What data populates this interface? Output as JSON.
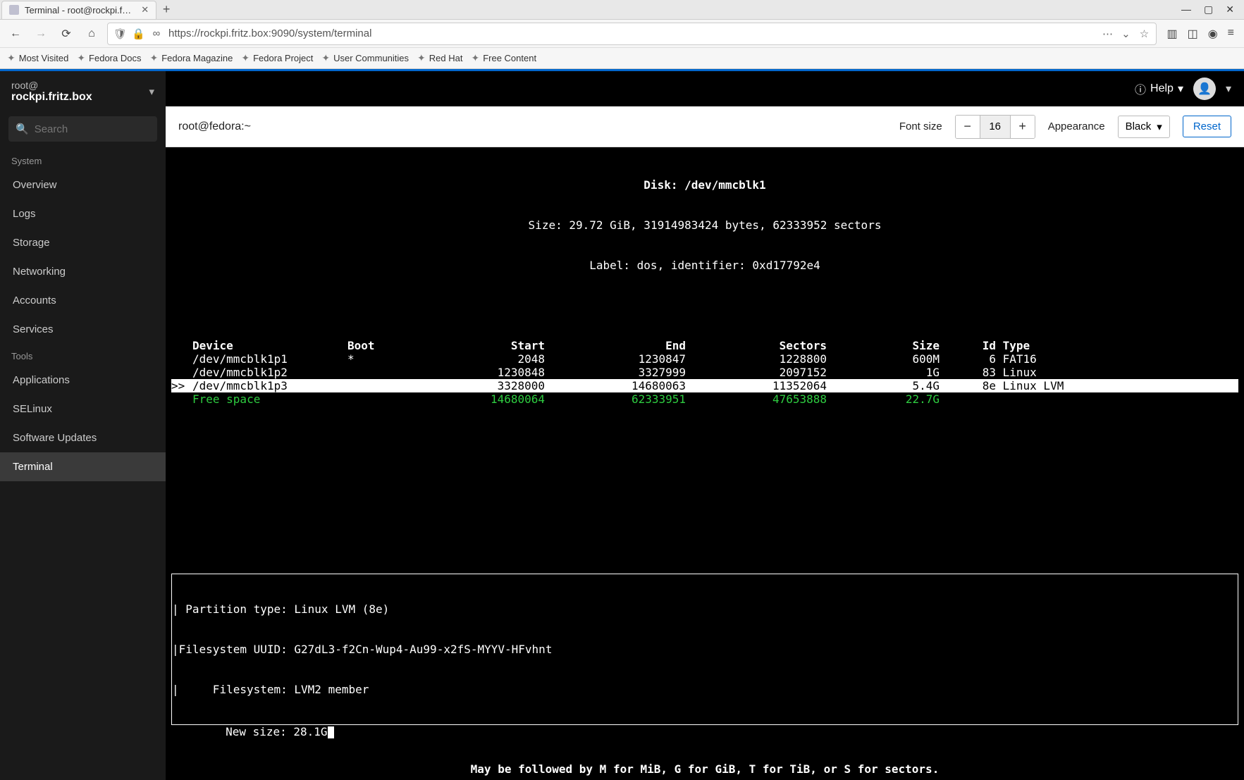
{
  "browser": {
    "tab_title": "Terminal - root@rockpi.f…",
    "url": "https://rockpi.fritz.box:9090/system/terminal",
    "window_controls": {
      "min": "—",
      "max": "▢",
      "close": "✕"
    },
    "bookmarks": [
      "Most Visited",
      "Fedora Docs",
      "Fedora Magazine",
      "Fedora Project",
      "User Communities",
      "Red Hat",
      "Free Content"
    ]
  },
  "sidebar": {
    "user": "root@",
    "host": "rockpi.fritz.box",
    "search_placeholder": "Search",
    "sections": {
      "system": {
        "label": "System",
        "items": [
          "Overview",
          "Logs",
          "Storage",
          "Networking",
          "Accounts",
          "Services"
        ]
      },
      "tools": {
        "label": "Tools",
        "items": [
          "Applications",
          "SELinux",
          "Software Updates",
          "Terminal"
        ]
      }
    },
    "active": "Terminal"
  },
  "header": {
    "help_label": "Help"
  },
  "toolbar": {
    "prompt": "root@fedora:~",
    "font_size_label": "Font size",
    "font_size_value": "16",
    "appearance_label": "Appearance",
    "appearance_value": "Black",
    "reset_label": "Reset"
  },
  "terminal": {
    "disk_line": "Disk: /dev/mmcblk1",
    "size_line": "Size: 29.72 GiB, 31914983424 bytes, 62333952 sectors",
    "label_line": "Label: dos, identifier: 0xd17792e4",
    "headers": [
      "Device",
      "Boot",
      "Start",
      "End",
      "Sectors",
      "Size",
      "Id",
      "Type"
    ],
    "rows": [
      {
        "sel": false,
        "device": "/dev/mmcblk1p1",
        "boot": "*",
        "start": "2048",
        "end": "1230847",
        "sectors": "1228800",
        "size": "600M",
        "id": "6",
        "type": "FAT16",
        "free": false
      },
      {
        "sel": false,
        "device": "/dev/mmcblk1p2",
        "boot": "",
        "start": "1230848",
        "end": "3327999",
        "sectors": "2097152",
        "size": "1G",
        "id": "83",
        "type": "Linux",
        "free": false
      },
      {
        "sel": true,
        "device": "/dev/mmcblk1p3",
        "boot": "",
        "start": "3328000",
        "end": "14680063",
        "sectors": "11352064",
        "size": "5.4G",
        "id": "8e",
        "type": "Linux LVM",
        "free": false
      },
      {
        "sel": false,
        "device": "Free space",
        "boot": "",
        "start": "14680064",
        "end": "62333951",
        "sectors": "47653888",
        "size": "22.7G",
        "id": "",
        "type": "",
        "free": true
      }
    ],
    "box": {
      "ptype": " Partition type: Linux LVM (8e)",
      "uuid": "Filesystem UUID: G27dL3-f2Cn-Wup4-Au99-x2fS-MYYV-HFvhnt",
      "fs": "     Filesystem: LVM2 member"
    },
    "newsize_label": "New size: ",
    "newsize_value": "28.1G",
    "hint": "May be followed by M for MiB, G for GiB, T for TiB, or S for sectors."
  }
}
